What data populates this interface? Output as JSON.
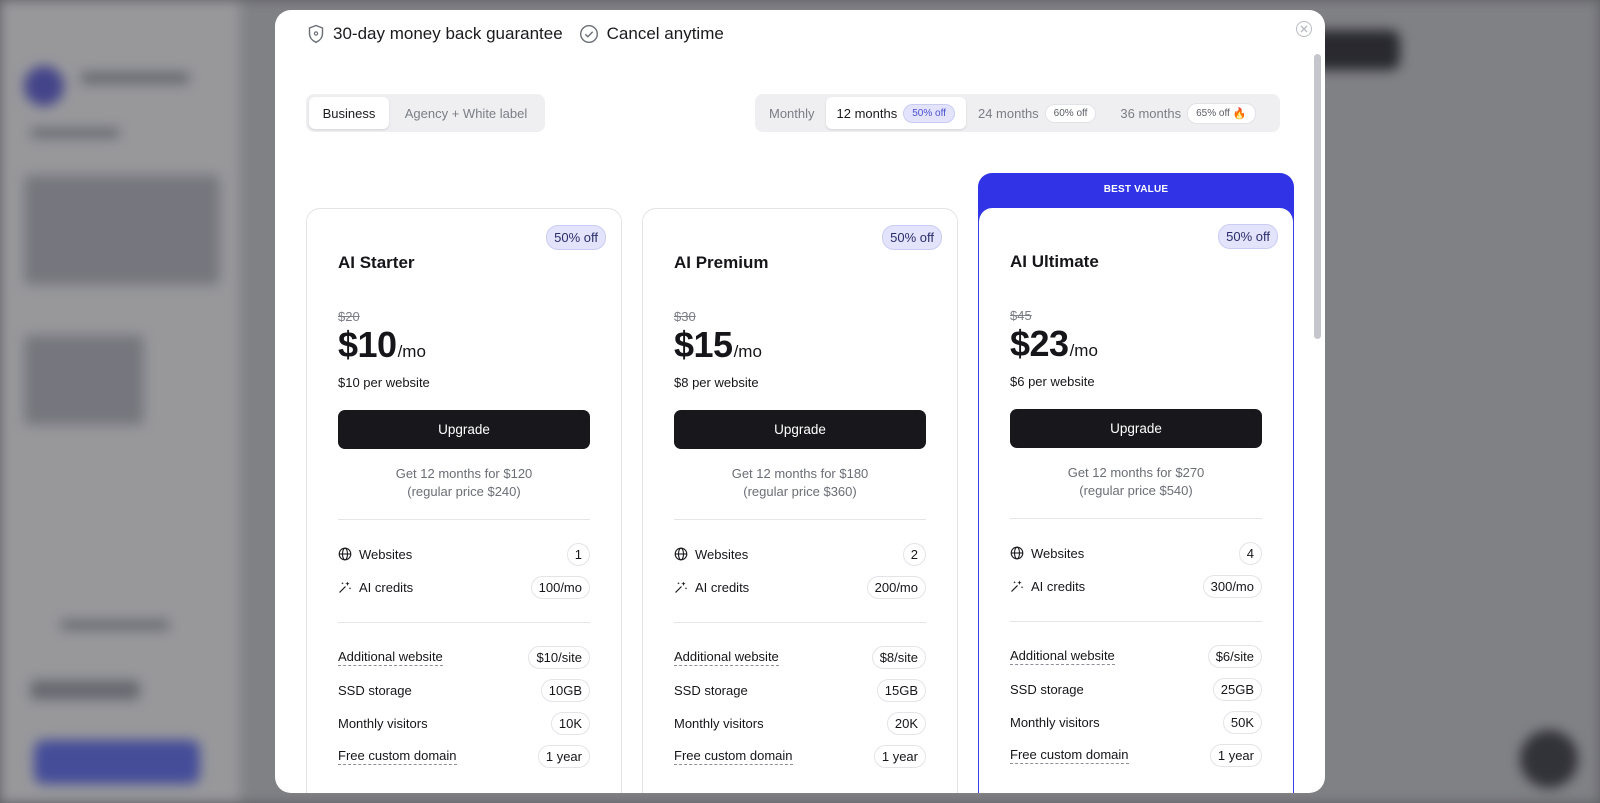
{
  "guarantee": {
    "money_back": "30-day money back guarantee",
    "cancel": "Cancel anytime"
  },
  "plan_type": {
    "options": [
      "Business",
      "Agency + White label"
    ],
    "selected": "Business"
  },
  "billing_period": {
    "options": [
      {
        "label": "Monthly",
        "discount": ""
      },
      {
        "label": "12 months",
        "discount": "50% off"
      },
      {
        "label": "24 months",
        "discount": "60% off"
      },
      {
        "label": "36 months",
        "discount": "65% off",
        "icon": "fire-icon"
      }
    ],
    "selected": "12 months"
  },
  "best_value_label": "BEST VALUE",
  "plans": [
    {
      "name": "AI Starter",
      "badge": "50% off",
      "old_price": "$20",
      "price": "$10",
      "period": "/mo",
      "per_site": "$10 per website",
      "cta": "Upgrade",
      "annual_line1": "Get 12 months for $120",
      "annual_line2": "(regular price $240)",
      "websites_label": "Websites",
      "websites": "1",
      "credits_label": "AI credits",
      "credits": "100/mo",
      "features": [
        {
          "label": "Additional website",
          "value": "$10/site",
          "dotted": true
        },
        {
          "label": "SSD storage",
          "value": "10GB",
          "dotted": false
        },
        {
          "label": "Monthly visitors",
          "value": "10K",
          "dotted": false
        },
        {
          "label": "Free custom domain",
          "value": "1 year",
          "dotted": true
        }
      ]
    },
    {
      "name": "AI Premium",
      "badge": "50% off",
      "old_price": "$30",
      "price": "$15",
      "period": "/mo",
      "per_site": "$8 per website",
      "cta": "Upgrade",
      "annual_line1": "Get 12 months for $180",
      "annual_line2": "(regular price $360)",
      "websites_label": "Websites",
      "websites": "2",
      "credits_label": "AI credits",
      "credits": "200/mo",
      "features": [
        {
          "label": "Additional website",
          "value": "$8/site",
          "dotted": true
        },
        {
          "label": "SSD storage",
          "value": "15GB",
          "dotted": false
        },
        {
          "label": "Monthly visitors",
          "value": "20K",
          "dotted": false
        },
        {
          "label": "Free custom domain",
          "value": "1 year",
          "dotted": true
        }
      ]
    },
    {
      "name": "AI Ultimate",
      "badge": "50% off",
      "old_price": "$45",
      "price": "$23",
      "period": "/mo",
      "per_site": "$6 per website",
      "cta": "Upgrade",
      "annual_line1": "Get 12 months for $270",
      "annual_line2": "(regular price $540)",
      "websites_label": "Websites",
      "websites": "4",
      "credits_label": "AI credits",
      "credits": "300/mo",
      "features": [
        {
          "label": "Additional website",
          "value": "$6/site",
          "dotted": true
        },
        {
          "label": "SSD storage",
          "value": "25GB",
          "dotted": false
        },
        {
          "label": "Monthly visitors",
          "value": "50K",
          "dotted": false
        },
        {
          "label": "Free custom domain",
          "value": "1 year",
          "dotted": true
        }
      ]
    }
  ],
  "colors": {
    "accent": "#3034e6",
    "button": "#17171c",
    "badge_bg": "#e3e4fb"
  }
}
